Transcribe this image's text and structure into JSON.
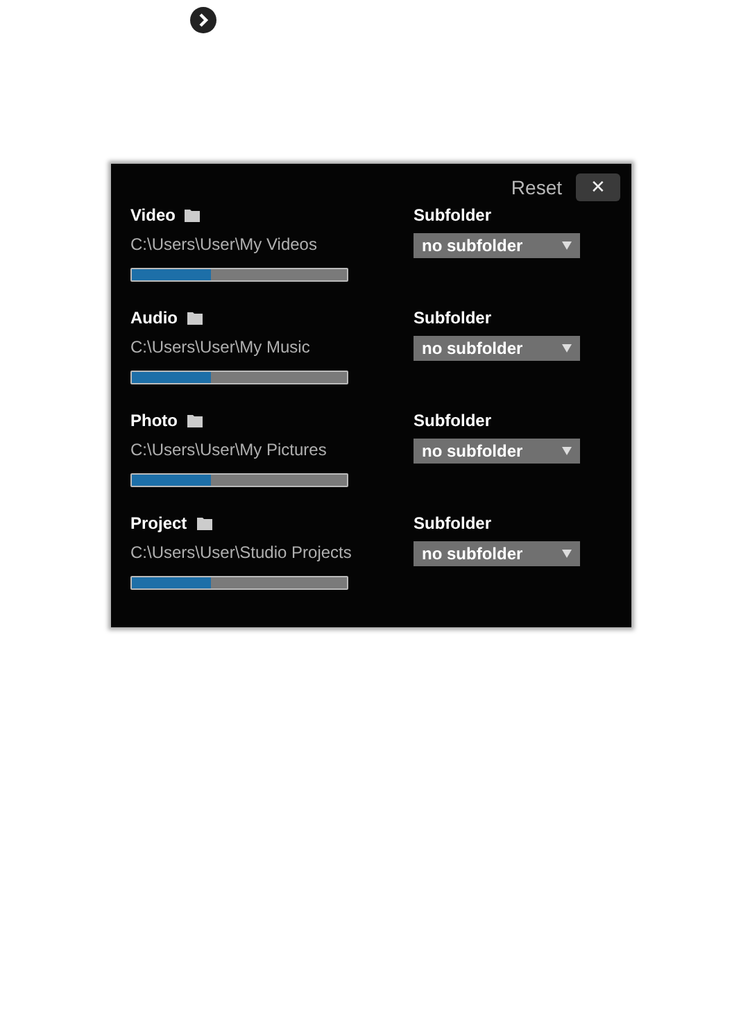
{
  "header": {
    "reset": "Reset",
    "close": "✕"
  },
  "folders": [
    {
      "label": "Video",
      "path": "C:\\Users\\User\\My Videos",
      "level": 0.37,
      "subfolder_label": "Subfolder",
      "subfolder": "no subfolder"
    },
    {
      "label": "Audio",
      "path": "C:\\Users\\User\\My Music",
      "level": 0.37,
      "subfolder_label": "Subfolder",
      "subfolder": "no subfolder"
    },
    {
      "label": "Photo",
      "path": "C:\\Users\\User\\My Pictures",
      "level": 0.37,
      "subfolder_label": "Subfolder",
      "subfolder": "no subfolder"
    },
    {
      "label": "Project",
      "path": "C:\\Users\\User\\Studio Projects",
      "level": 0.37,
      "subfolder_label": "Subfolder",
      "subfolder": "no subfolder"
    }
  ]
}
